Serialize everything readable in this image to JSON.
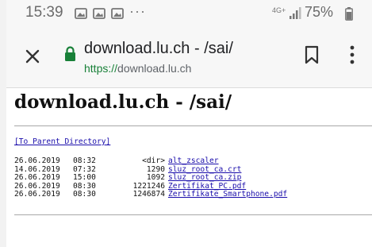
{
  "status_bar": {
    "time": "15:39",
    "more": "···",
    "network": "4G+",
    "battery": "75%"
  },
  "browser": {
    "title": "download.lu.ch - /sai/",
    "url_scheme": "https://",
    "url_host": "download.lu.ch"
  },
  "page": {
    "heading": "download.lu.ch - /sai/",
    "parent_link": "[To Parent Directory]",
    "files": [
      {
        "date": "26.06.2019",
        "time": "08:32",
        "size": "<dir>",
        "name": "alt_zscaler"
      },
      {
        "date": "14.06.2019",
        "time": "07:32",
        "size": "1290",
        "name": "sluz_root_ca.crt"
      },
      {
        "date": "26.06.2019",
        "time": "15:00",
        "size": "1092",
        "name": "sluz_root_ca.zip"
      },
      {
        "date": "26.06.2019",
        "time": "08:30",
        "size": "1221246",
        "name": "Zertifikat_PC.pdf"
      },
      {
        "date": "26.06.2019",
        "time": "08:30",
        "size": "1246874",
        "name": "Zertifikate_Smartphone.pdf"
      }
    ]
  },
  "colors": {
    "link": "#1a0dab",
    "secure": "#188038"
  }
}
